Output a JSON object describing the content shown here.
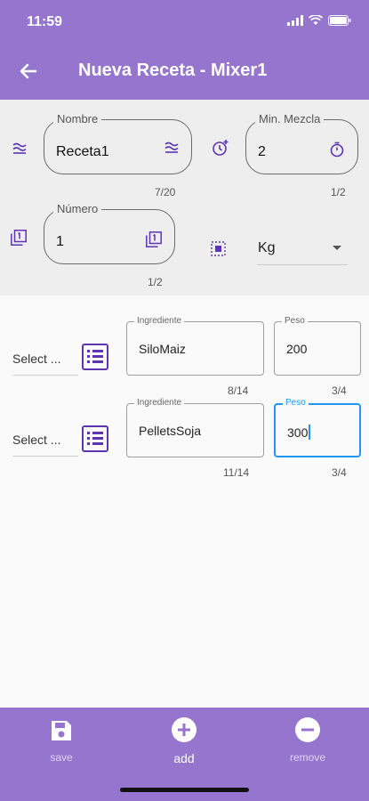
{
  "status": {
    "time": "11:59"
  },
  "appbar": {
    "title": "Nueva Receta - Mixer1"
  },
  "header": {
    "nombre": {
      "label": "Nombre",
      "value": "Receta1",
      "counter": "7/20"
    },
    "mezcla": {
      "label": "Min. Mezcla",
      "value": "2",
      "counter": "1/2"
    },
    "numero": {
      "label": "Número",
      "value": "1",
      "counter": "1/2"
    },
    "unit": {
      "value": "Kg"
    }
  },
  "rows": [
    {
      "select": "Select ...",
      "ingrediente_label": "Ingrediente",
      "ingrediente": "SiloMaiz",
      "ingrediente_counter": "8/14",
      "peso_label": "Peso",
      "peso": "200",
      "peso_counter": "3/4"
    },
    {
      "select": "Select ...",
      "ingrediente_label": "Ingrediente",
      "ingrediente": "PelletsSoja",
      "ingrediente_counter": "11/14",
      "peso_label": "Peso",
      "peso": "300",
      "peso_counter": "3/4"
    }
  ],
  "bottom_nav": {
    "save": "save",
    "add": "add",
    "remove": "remove"
  },
  "colors": {
    "primary": "#9575cd",
    "icon": "#5e35b1",
    "focus": "#2196f3"
  },
  "icons": [
    "arrow-back-icon",
    "wifi-icon",
    "battery-icon",
    "signal-icon",
    "approx-equal-icon",
    "timer-icon",
    "alarm-add-icon",
    "filter-1-icon",
    "select-all-icon",
    "list-icon",
    "save-icon",
    "add-circle-icon",
    "remove-circle-icon"
  ]
}
